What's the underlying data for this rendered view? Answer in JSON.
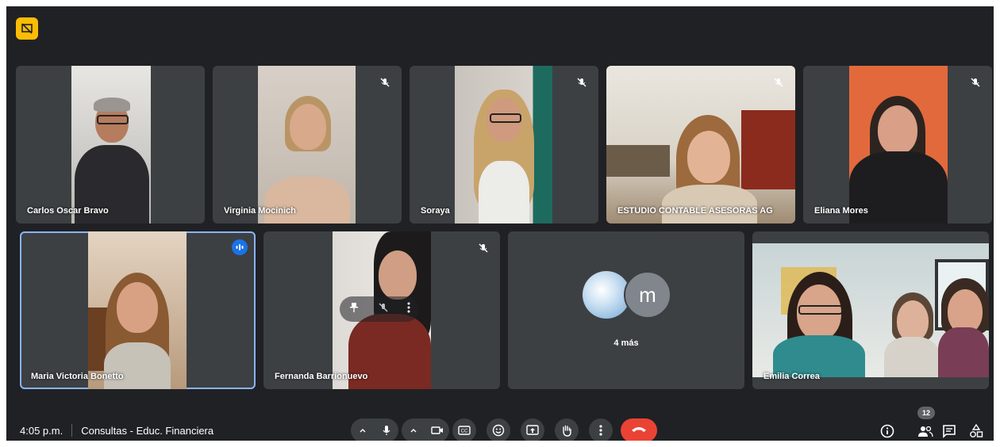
{
  "meeting": {
    "time": "4:05 p.m.",
    "title": "Consultas - Educ. Financiera"
  },
  "participants": [
    {
      "name": "Carlos Oscar Bravo",
      "muted": false
    },
    {
      "name": "Virginia Mocinich",
      "muted": true
    },
    {
      "name": "Soraya",
      "muted": true
    },
    {
      "name": "ESTUDIO CONTABLE ASESORAS AG",
      "muted": true
    },
    {
      "name": "Eliana Mores",
      "muted": true
    },
    {
      "name": "Maria Victoria Bonetto",
      "muted": false,
      "speaking": true
    },
    {
      "name": "Fernanda Barrionuevo",
      "muted": true
    },
    {
      "name": "Emilia Correa",
      "muted": false
    }
  ],
  "overflow": {
    "label": "4 más",
    "avatar_letter": "m"
  },
  "people_count": "12",
  "colors": {
    "background": "#202124",
    "tile": "#3c4043",
    "end_call": "#ea4335",
    "active_outline": "#8ab4f8",
    "badge": "#fbbc04"
  },
  "icons": {
    "top_badge": "presentation-off-icon",
    "mic": "mic-icon",
    "camera": "camera-icon",
    "captions": "captions-icon",
    "emoji": "emoji-icon",
    "present": "present-screen-icon",
    "raise_hand": "raise-hand-icon",
    "more": "more-options-icon",
    "end": "end-call-icon",
    "info": "info-icon",
    "people": "people-icon",
    "chat": "chat-icon",
    "activities": "activities-icon"
  }
}
